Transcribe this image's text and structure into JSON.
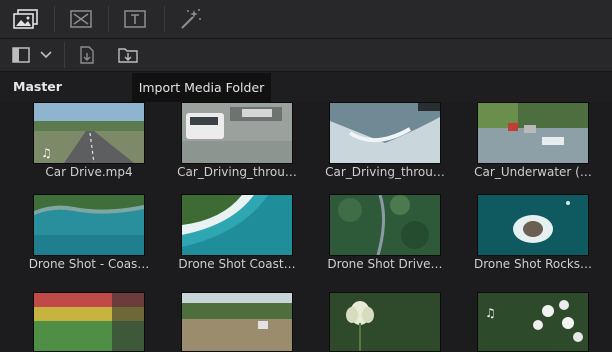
{
  "toolbar": {
    "media_pool_icon": "media-pool-icon",
    "effects_icon": "effects-icon",
    "titles_icon": "titles-icon",
    "fx_icon": "magic-wand-icon"
  },
  "subtoolbar": {
    "panel_toggle_icon": "panel-toggle-icon",
    "dropdown_icon": "chevron-down-icon",
    "import_media_icon": "import-media-icon",
    "import_folder_icon": "import-folder-icon"
  },
  "bin": {
    "title": "Master"
  },
  "tooltip": {
    "text": "Import Media Folder"
  },
  "clips": [
    {
      "name": "Car Drive.mp4",
      "has_audio": true
    },
    {
      "name": "Car_Driving_throu…",
      "has_audio": false
    },
    {
      "name": "Car_Driving_throu…",
      "has_audio": false
    },
    {
      "name": "Car_Underwater (…",
      "has_audio": false
    },
    {
      "name": "Drone Shot - Coas…",
      "has_audio": false
    },
    {
      "name": "Drone Shot Coast…",
      "has_audio": false
    },
    {
      "name": "Drone Shot Drive…",
      "has_audio": false
    },
    {
      "name": "Drone Shot Rocks…",
      "has_audio": false
    },
    {
      "name": "",
      "has_audio": false
    },
    {
      "name": "",
      "has_audio": false
    },
    {
      "name": "",
      "has_audio": false
    },
    {
      "name": "",
      "has_audio": true
    }
  ],
  "audio_symbol": "♫"
}
